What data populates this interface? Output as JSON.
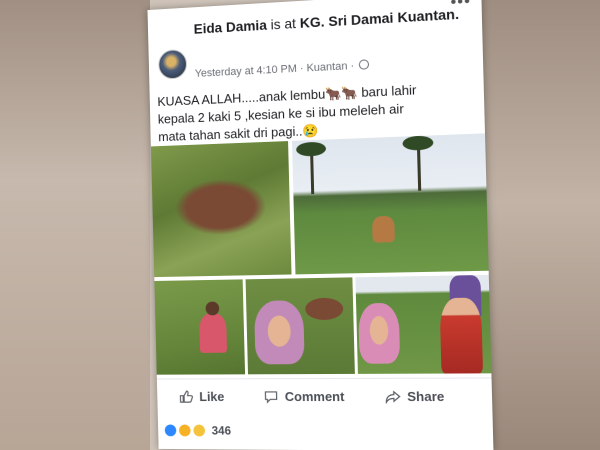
{
  "post": {
    "author": "Eida Damia",
    "verb": "is at",
    "place": "KG. Sri Damai Kuantan.",
    "time": "Yesterday at 4:10 PM",
    "location": "Kuantan",
    "text_line1": "KUASA ALLAH.....anak lembu🐂🐂 baru lahir",
    "text_line2": "kepala 2 kaki 5 ,kesian ke si ibu meleleh air",
    "text_line3": "mata tahan sakit dri pagi..😢"
  },
  "actions": {
    "like": "Like",
    "comment": "Comment",
    "share": "Share"
  },
  "reactions": {
    "count": "346",
    "types": [
      "like-icon",
      "sad-icon",
      "wow-icon"
    ]
  },
  "icons": {
    "avatar": "avatar",
    "globe": "globe-icon",
    "more": "more-icon"
  }
}
